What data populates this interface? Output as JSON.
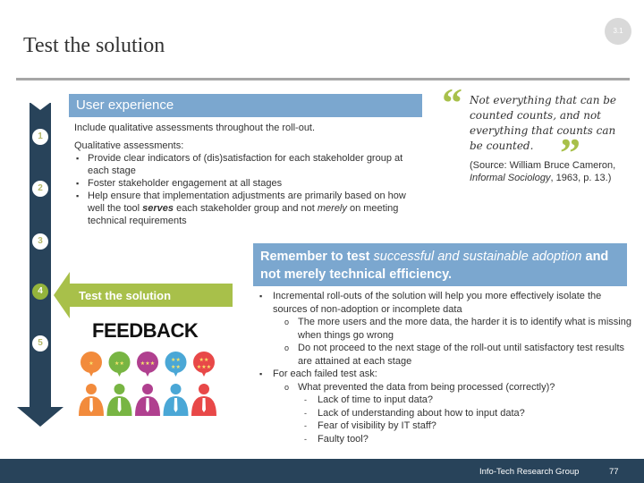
{
  "header": {
    "section_badge": "3.1",
    "title": "Test the solution"
  },
  "timeline": {
    "steps": [
      "1",
      "2",
      "3",
      "4",
      "5"
    ],
    "active_step": "4",
    "colors": {
      "bar": "#28435a",
      "active": "#94b43c",
      "inactive_text": "#b5b86a"
    }
  },
  "user_experience": {
    "heading": "User experience",
    "intro": "Include qualitative assessments throughout the roll-out.",
    "list_heading": "Qualitative assessments:",
    "bullets": [
      {
        "text": "Provide clear indicators of (dis)satisfaction for each stakeholder group at each stage"
      },
      {
        "text": "Foster stakeholder engagement at all stages"
      },
      {
        "pre": "Help ensure that implementation adjustments are primarily based on how well the tool ",
        "bold_italic": "serves",
        "mid": " each stakeholder group and not ",
        "italic": "merely",
        "post": " on meeting technical requirements"
      }
    ]
  },
  "quote": {
    "open_mark": "“",
    "close_mark": "”",
    "text": "Not everything that can be counted counts, and not everything that counts can be counted.",
    "source_pre": "(Source: William Bruce Cameron, ",
    "source_title": "Informal Sociology",
    "source_post": ", 1963, p. 13.)"
  },
  "green_arrow": {
    "label": "Test the solution",
    "color": "#a8c04a"
  },
  "feedback": {
    "title": "FEEDBACK",
    "people": [
      {
        "color": "#f28b3c",
        "stars": 1
      },
      {
        "color": "#78b543",
        "stars": 2
      },
      {
        "color": "#b0408f",
        "stars": 3
      },
      {
        "color": "#4aa7d6",
        "stars": 4
      },
      {
        "color": "#e84848",
        "stars": 5
      }
    ]
  },
  "remember": {
    "pre": "Remember to test ",
    "italic": "successful and sustainable adoption",
    "post": " and not merely technical efficiency."
  },
  "details": {
    "bullet1": "Incremental roll-outs of the solution will help you more effectively isolate the sources of non-adoption or incomplete data",
    "bullet1_sub": [
      "The more users and the more data, the harder it is to identify what is missing when things go wrong",
      "Do not proceed to the next stage of the roll-out until satisfactory test results are attained at each stage"
    ],
    "bullet2": "For each failed test ask:",
    "bullet2_sub": "What prevented the data from being processed (correctly)?",
    "questions": [
      "Lack of time to input data?",
      "Lack of understanding about how to input data?",
      "Fear of visibility by IT staff?",
      "Faulty tool?"
    ]
  },
  "footer": {
    "org": "Info-Tech Research Group",
    "page": "77"
  }
}
